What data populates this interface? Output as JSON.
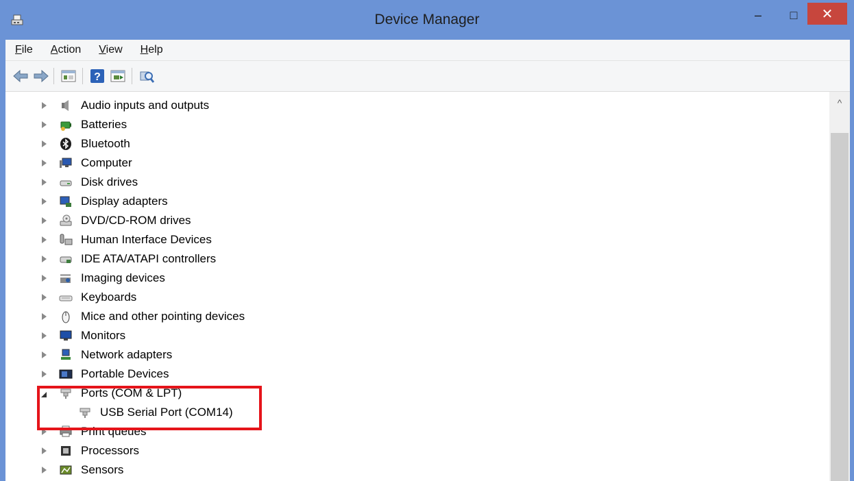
{
  "window": {
    "title": "Device Manager",
    "minimize_glyph": "–",
    "maximize_glyph": "□",
    "close_glyph": "✕"
  },
  "menu": {
    "file": {
      "u": "F",
      "rest": "ile"
    },
    "action": {
      "u": "A",
      "rest": "ction"
    },
    "view": {
      "u": "V",
      "rest": "iew"
    },
    "help": {
      "u": "H",
      "rest": "elp"
    }
  },
  "toolbar": {
    "icons": [
      "back-icon",
      "forward-icon",
      "properties-icon",
      "help-icon",
      "update-driver-icon",
      "scan-hardware-icon"
    ]
  },
  "tree": {
    "categories": [
      {
        "label": "Audio inputs and outputs",
        "icon": "speaker-icon",
        "expanded": false
      },
      {
        "label": "Batteries",
        "icon": "battery-icon",
        "expanded": false
      },
      {
        "label": "Bluetooth",
        "icon": "bluetooth-icon",
        "expanded": false
      },
      {
        "label": "Computer",
        "icon": "computer-icon",
        "expanded": false
      },
      {
        "label": "Disk drives",
        "icon": "disk-drive-icon",
        "expanded": false
      },
      {
        "label": "Display adapters",
        "icon": "display-adapter-icon",
        "expanded": false
      },
      {
        "label": "DVD/CD-ROM drives",
        "icon": "dvd-drive-icon",
        "expanded": false
      },
      {
        "label": "Human Interface Devices",
        "icon": "hid-icon",
        "expanded": false
      },
      {
        "label": "IDE ATA/ATAPI controllers",
        "icon": "ide-controller-icon",
        "expanded": false
      },
      {
        "label": "Imaging devices",
        "icon": "camera-icon",
        "expanded": false
      },
      {
        "label": "Keyboards",
        "icon": "keyboard-icon",
        "expanded": false
      },
      {
        "label": "Mice and other pointing devices",
        "icon": "mouse-icon",
        "expanded": false
      },
      {
        "label": "Monitors",
        "icon": "monitor-icon",
        "expanded": false
      },
      {
        "label": "Network adapters",
        "icon": "network-adapter-icon",
        "expanded": false
      },
      {
        "label": "Portable Devices",
        "icon": "portable-device-icon",
        "expanded": false
      },
      {
        "label": "Ports (COM & LPT)",
        "icon": "port-icon",
        "expanded": true,
        "children": [
          {
            "label": "USB Serial Port (COM14)",
            "icon": "port-icon"
          }
        ]
      },
      {
        "label": "Print queues",
        "icon": "printer-icon",
        "expanded": false
      },
      {
        "label": "Processors",
        "icon": "processor-icon",
        "expanded": false
      },
      {
        "label": "Sensors",
        "icon": "sensor-icon",
        "expanded": false
      }
    ]
  },
  "scrollbar": {
    "up_glyph": "^"
  },
  "colors": {
    "titlebar": "#6b93d6",
    "close_button": "#c7463d",
    "highlight_box": "#e5141a"
  }
}
